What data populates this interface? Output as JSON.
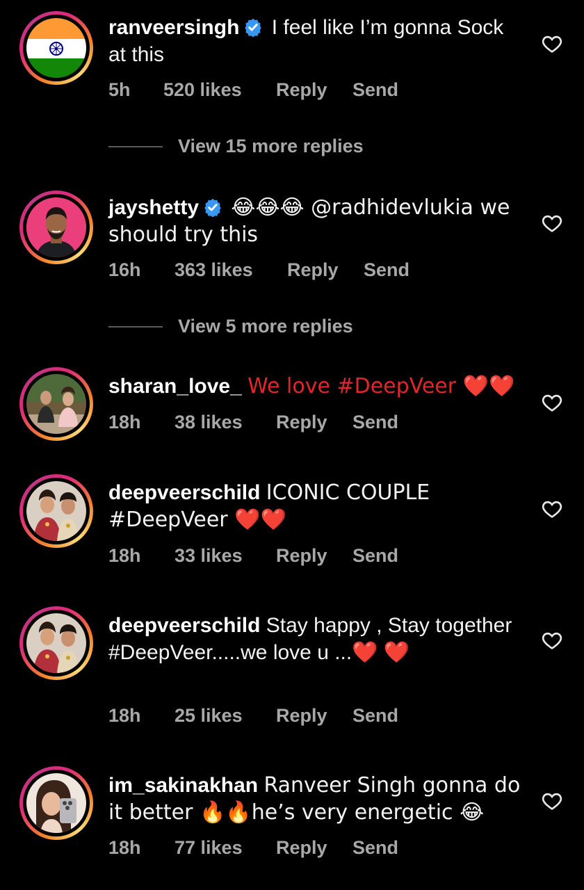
{
  "colors": {
    "background": "#000000",
    "text": "#f2f2f2",
    "meta": "#a8a8a8",
    "verified": "#3897f0",
    "heart_emoji": "#e0262b"
  },
  "comments": [
    {
      "username": "ranveersingh",
      "verified": true,
      "text": "I feel like I’m gonna Sock at this",
      "time": "5h",
      "likes": "520 likes",
      "reply": "Reply",
      "send": "Send",
      "avatar_icon": "india-flag-avatar",
      "view_more": "View 15 more replies"
    },
    {
      "username": "jayshetty",
      "verified": true,
      "text": "😂😂😂 @radhidevlukia we should try this",
      "time": "16h",
      "likes": "363 likes",
      "reply": "Reply",
      "send": "Send",
      "avatar_icon": "man-portrait-avatar",
      "view_more": "View 5 more replies"
    },
    {
      "username": "sharan_love_",
      "verified": false,
      "text": "We love #DeepVeer ❤️❤️",
      "time": "18h",
      "likes": "38 likes",
      "reply": "Reply",
      "send": "Send",
      "avatar_icon": "couple-photo-avatar"
    },
    {
      "username": "deepveerschild",
      "verified": false,
      "text": "ICONIC COUPLE #DeepVeer ❤️❤️",
      "time": "18h",
      "likes": "33 likes",
      "reply": "Reply",
      "send": "Send",
      "avatar_icon": "couple-wedding-avatar"
    },
    {
      "username": "deepveerschild",
      "verified": false,
      "text": "Stay happy , Stay together #DeepVeer.....we love u ...❤️ ❤️",
      "time": "18h",
      "likes": "25 likes",
      "reply": "Reply",
      "send": "Send",
      "avatar_icon": "couple-wedding-avatar"
    },
    {
      "username": "im_sakinakhan",
      "verified": false,
      "text": "Ranveer Singh gonna do it better 🔥🔥he’s very energetic 😂",
      "time": "18h",
      "likes": "77 likes",
      "reply": "Reply",
      "send": "Send",
      "avatar_icon": "woman-selfie-avatar"
    }
  ]
}
